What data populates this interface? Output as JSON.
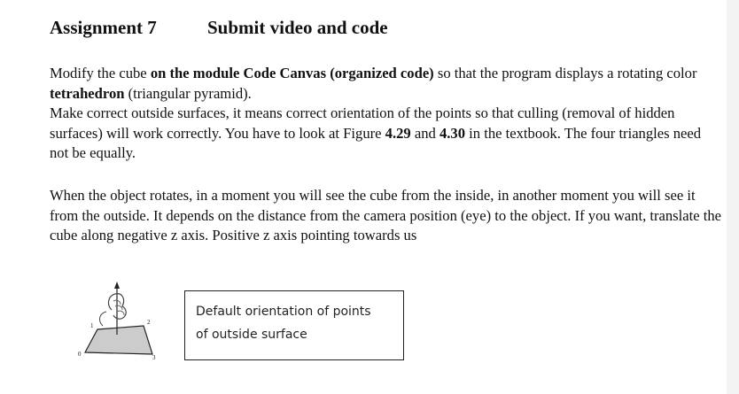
{
  "heading": {
    "assignment": "Assignment 7",
    "submit": "Submit video and code"
  },
  "paragraph1": {
    "t1": "Modify the cube ",
    "b1": "on the module Code Canvas (organized code)",
    "t2": " so that the program displays a rotating color ",
    "b2": "tetrahedron",
    "t3": " (triangular pyramid).",
    "t4": "Make correct outside surfaces, it means correct orientation of the points so that culling (removal of hidden surfaces) will work correctly. You have to look at Figure ",
    "b3": "4.29",
    "t5": " and ",
    "b4": "4.30",
    "t6": " in the textbook. The four triangles need not be equally."
  },
  "paragraph2": "When the object rotates, in a moment you will see the cube from the inside, in another moment you will see it from the outside. It depends on the distance from the camera position (eye) to the object. If you want, translate the cube along negative z axis. Positive z axis pointing towards us",
  "figure": {
    "labels": [
      "0",
      "1",
      "2",
      "3"
    ]
  },
  "note_box": {
    "line1": "Default orientation of points",
    "line2": "of outside surface"
  },
  "colors": {
    "face_fill": "#cccccc",
    "text": "#111111",
    "box_border": "#222222"
  }
}
